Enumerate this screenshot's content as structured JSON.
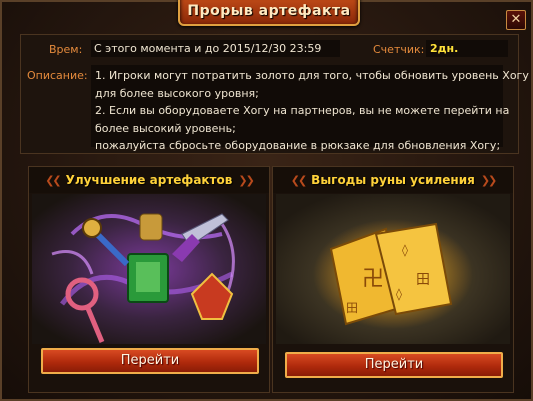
{
  "window": {
    "title": "Прорыв артефакта",
    "close_glyph": "✕"
  },
  "info": {
    "time_label": "Врем:",
    "time_value": "С этого момента и до 2015/12/30 23:59",
    "counter_label": "Счетчик:",
    "counter_value": "2дн.",
    "description_label": "Описание:",
    "description_lines": [
      "1. Игроки могут потратить золото для того, чтобы обновить уровень Хогу",
      "для более высокого уровня;",
      "2. Если вы оборудоваете  Хогу на партнеров, вы не можете перейти на",
      "более высокий уровень;",
      "пожалуйста сбросьте оборудование в рюкзаке для обновления  Хогу;"
    ]
  },
  "cards": [
    {
      "title": "Улучшение артефактов",
      "ornament_left": "❮❮",
      "ornament_right": "❯❯",
      "button_label": "Перейти",
      "art_icon": "artifacts-icon"
    },
    {
      "title": "Выгоды руны усиления",
      "ornament_left": "❮❮",
      "ornament_right": "❯❯",
      "button_label": "Перейти",
      "art_icon": "rune-scrolls-icon"
    }
  ],
  "colors": {
    "label": "#e48a3c",
    "counter": "#ffe23a",
    "card_title": "#ffd23a",
    "button": "#c8381a"
  }
}
